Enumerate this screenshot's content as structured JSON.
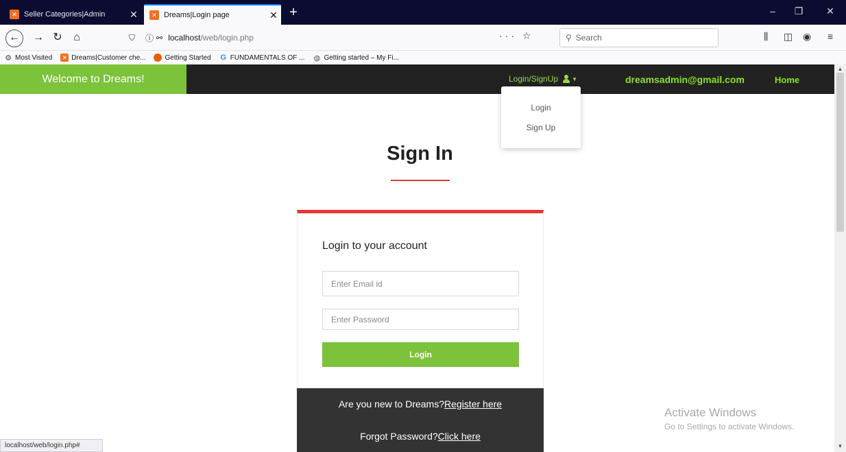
{
  "browser": {
    "tabs": [
      {
        "title": "Seller Categories|Admin",
        "active": false
      },
      {
        "title": "Dreams|Login page",
        "active": true
      }
    ],
    "url_host": "localhost",
    "url_path": "/web/login.php",
    "url_actions": "··· ☆",
    "search_placeholder": "Search",
    "bookmarks": [
      {
        "label": "Most Visited",
        "icon": "gear-icon"
      },
      {
        "label": "Dreams|Customer che...",
        "icon": "xampp-icon"
      },
      {
        "label": "Getting Started",
        "icon": "firefox-icon"
      },
      {
        "label": "FUNDAMENTALS OF ...",
        "icon": "google-icon"
      },
      {
        "label": "Getting started – My Fi...",
        "icon": "globe-icon"
      }
    ],
    "status_url": "localhost/web/login.php#"
  },
  "header": {
    "welcome": "Welcome to Dreams!",
    "login_signup": "Login/SignUp",
    "admin_email": "dreamsadmin@gmail.com",
    "home": "Home"
  },
  "dropdown": {
    "items": [
      "Login",
      "Sign Up"
    ]
  },
  "main": {
    "title": "Sign In",
    "card_heading": "Login to your account",
    "email_placeholder": "Enter Email id",
    "password_placeholder": "Enter Password",
    "login_button": "Login",
    "register_prompt": "Are you new to Dreams?",
    "register_link": "Register here",
    "forgot_prompt": "Forgot Password?",
    "forgot_link": "Click here"
  },
  "watermark": {
    "title": "Activate Windows",
    "subtitle": "Go to Settings to activate Windows."
  },
  "colors": {
    "accent_green": "#7cc23a",
    "header_dark": "#222222",
    "underline_red": "#e53935"
  }
}
